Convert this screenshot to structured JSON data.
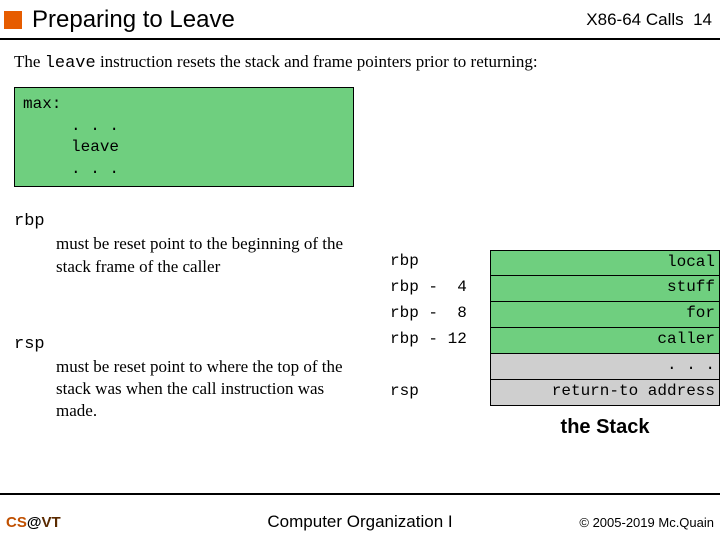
{
  "header": {
    "title": "Preparing to Leave",
    "topic": "X86-64 Calls",
    "pagenum": "14"
  },
  "intro": {
    "pre": "The ",
    "code": "leave",
    "post": " instruction resets the stack and frame pointers prior to returning:"
  },
  "codebox": "max:\n     . . .\n     leave\n     . . .",
  "para_rbp": {
    "reg": "rbp",
    "rest": " must be reset point to the beginning of the stack frame of the caller"
  },
  "para_rsp": {
    "reg": "rsp",
    "rest": " must be reset point to where the top of the stack was when the call instruction was made."
  },
  "stack": {
    "rows": [
      {
        "label": "rbp",
        "cell": "local",
        "color": "green",
        "first": true
      },
      {
        "label": "rbp -  4",
        "cell": "stuff",
        "color": "green"
      },
      {
        "label": "rbp -  8",
        "cell": "for",
        "color": "green"
      },
      {
        "label": "rbp - 12",
        "cell": "caller",
        "color": "green"
      },
      {
        "label": "",
        "cell": ". . .",
        "color": "grey"
      },
      {
        "label": "rsp",
        "cell": "return-to address",
        "color": "grey"
      }
    ],
    "caption": "the Stack"
  },
  "footer": {
    "left": {
      "cs": "CS",
      "at": "@",
      "vt": "VT"
    },
    "center": "Computer Organization I",
    "right": "© 2005-2019 Mc.Quain"
  }
}
